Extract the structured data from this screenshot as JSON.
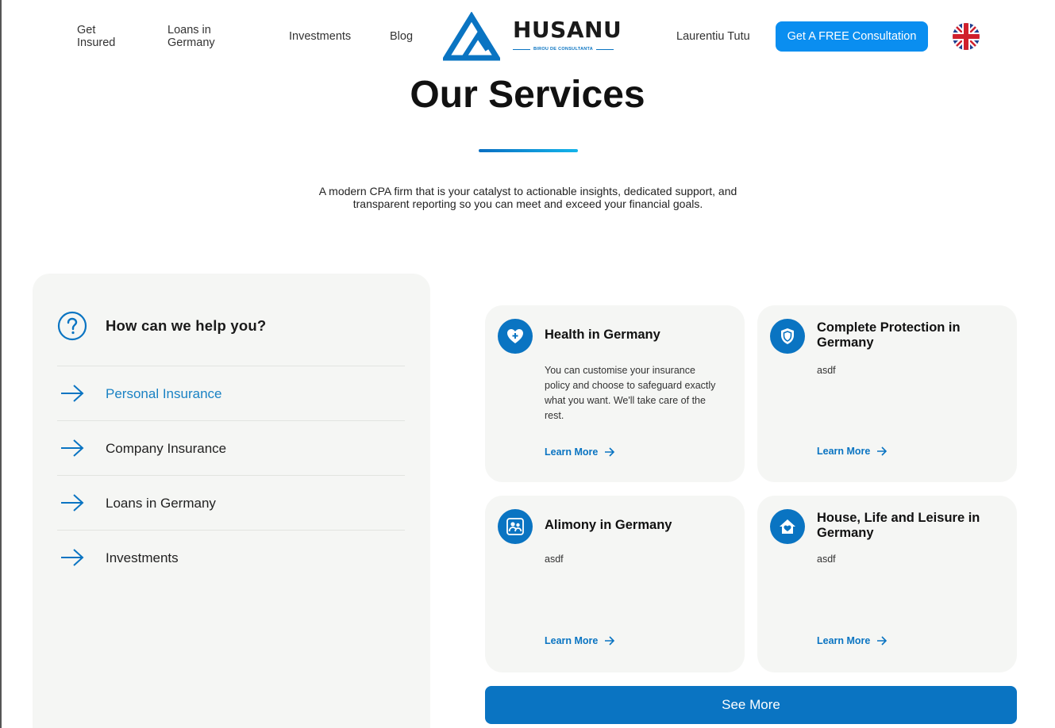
{
  "header": {
    "nav_left": [
      "Get\nInsured",
      "Loans in\nGermany",
      "Investments",
      "Blog"
    ],
    "logo_text": "HUSANU",
    "logo_subtitle": "BIROU DE CONSULTANTA",
    "user_name": "Laurentiu Tutu",
    "cta_label": "Get A FREE Consultation",
    "language_flag": "uk-flag-icon"
  },
  "hero": {
    "title": "Our Services",
    "intro": "A modern CPA firm that is your catalyst to actionable insights, dedicated support, and transparent reporting so you can meet and exceed your financial goals."
  },
  "help": {
    "title": "How can we help you?",
    "items": [
      {
        "label": "Personal Insurance",
        "active": true
      },
      {
        "label": "Company Insurance",
        "active": false
      },
      {
        "label": "Loans in Germany",
        "active": false
      },
      {
        "label": "Investments",
        "active": false
      }
    ]
  },
  "cards": [
    {
      "title": "Health in Germany",
      "desc": "You can customise your insurance policy and choose to safeguard exactly what you want. We'll take care of the rest.",
      "link": "Learn More",
      "icon": "heart-shield-icon"
    },
    {
      "title": "Complete Protection in Germany",
      "desc": "asdf",
      "link": "Learn More",
      "icon": "shield-icon"
    },
    {
      "title": "Alimony in Germany",
      "desc": "asdf",
      "link": "Learn More",
      "icon": "family-icon"
    },
    {
      "title": "House, Life and Leisure in Germany",
      "desc": "asdf",
      "link": "Learn More",
      "icon": "house-heart-icon"
    }
  ],
  "see_more_label": "See More",
  "colors": {
    "primary": "#0a74c2",
    "cta": "#0a8ef0",
    "panel": "#f5f6f4",
    "active_link": "#1a82c4"
  }
}
